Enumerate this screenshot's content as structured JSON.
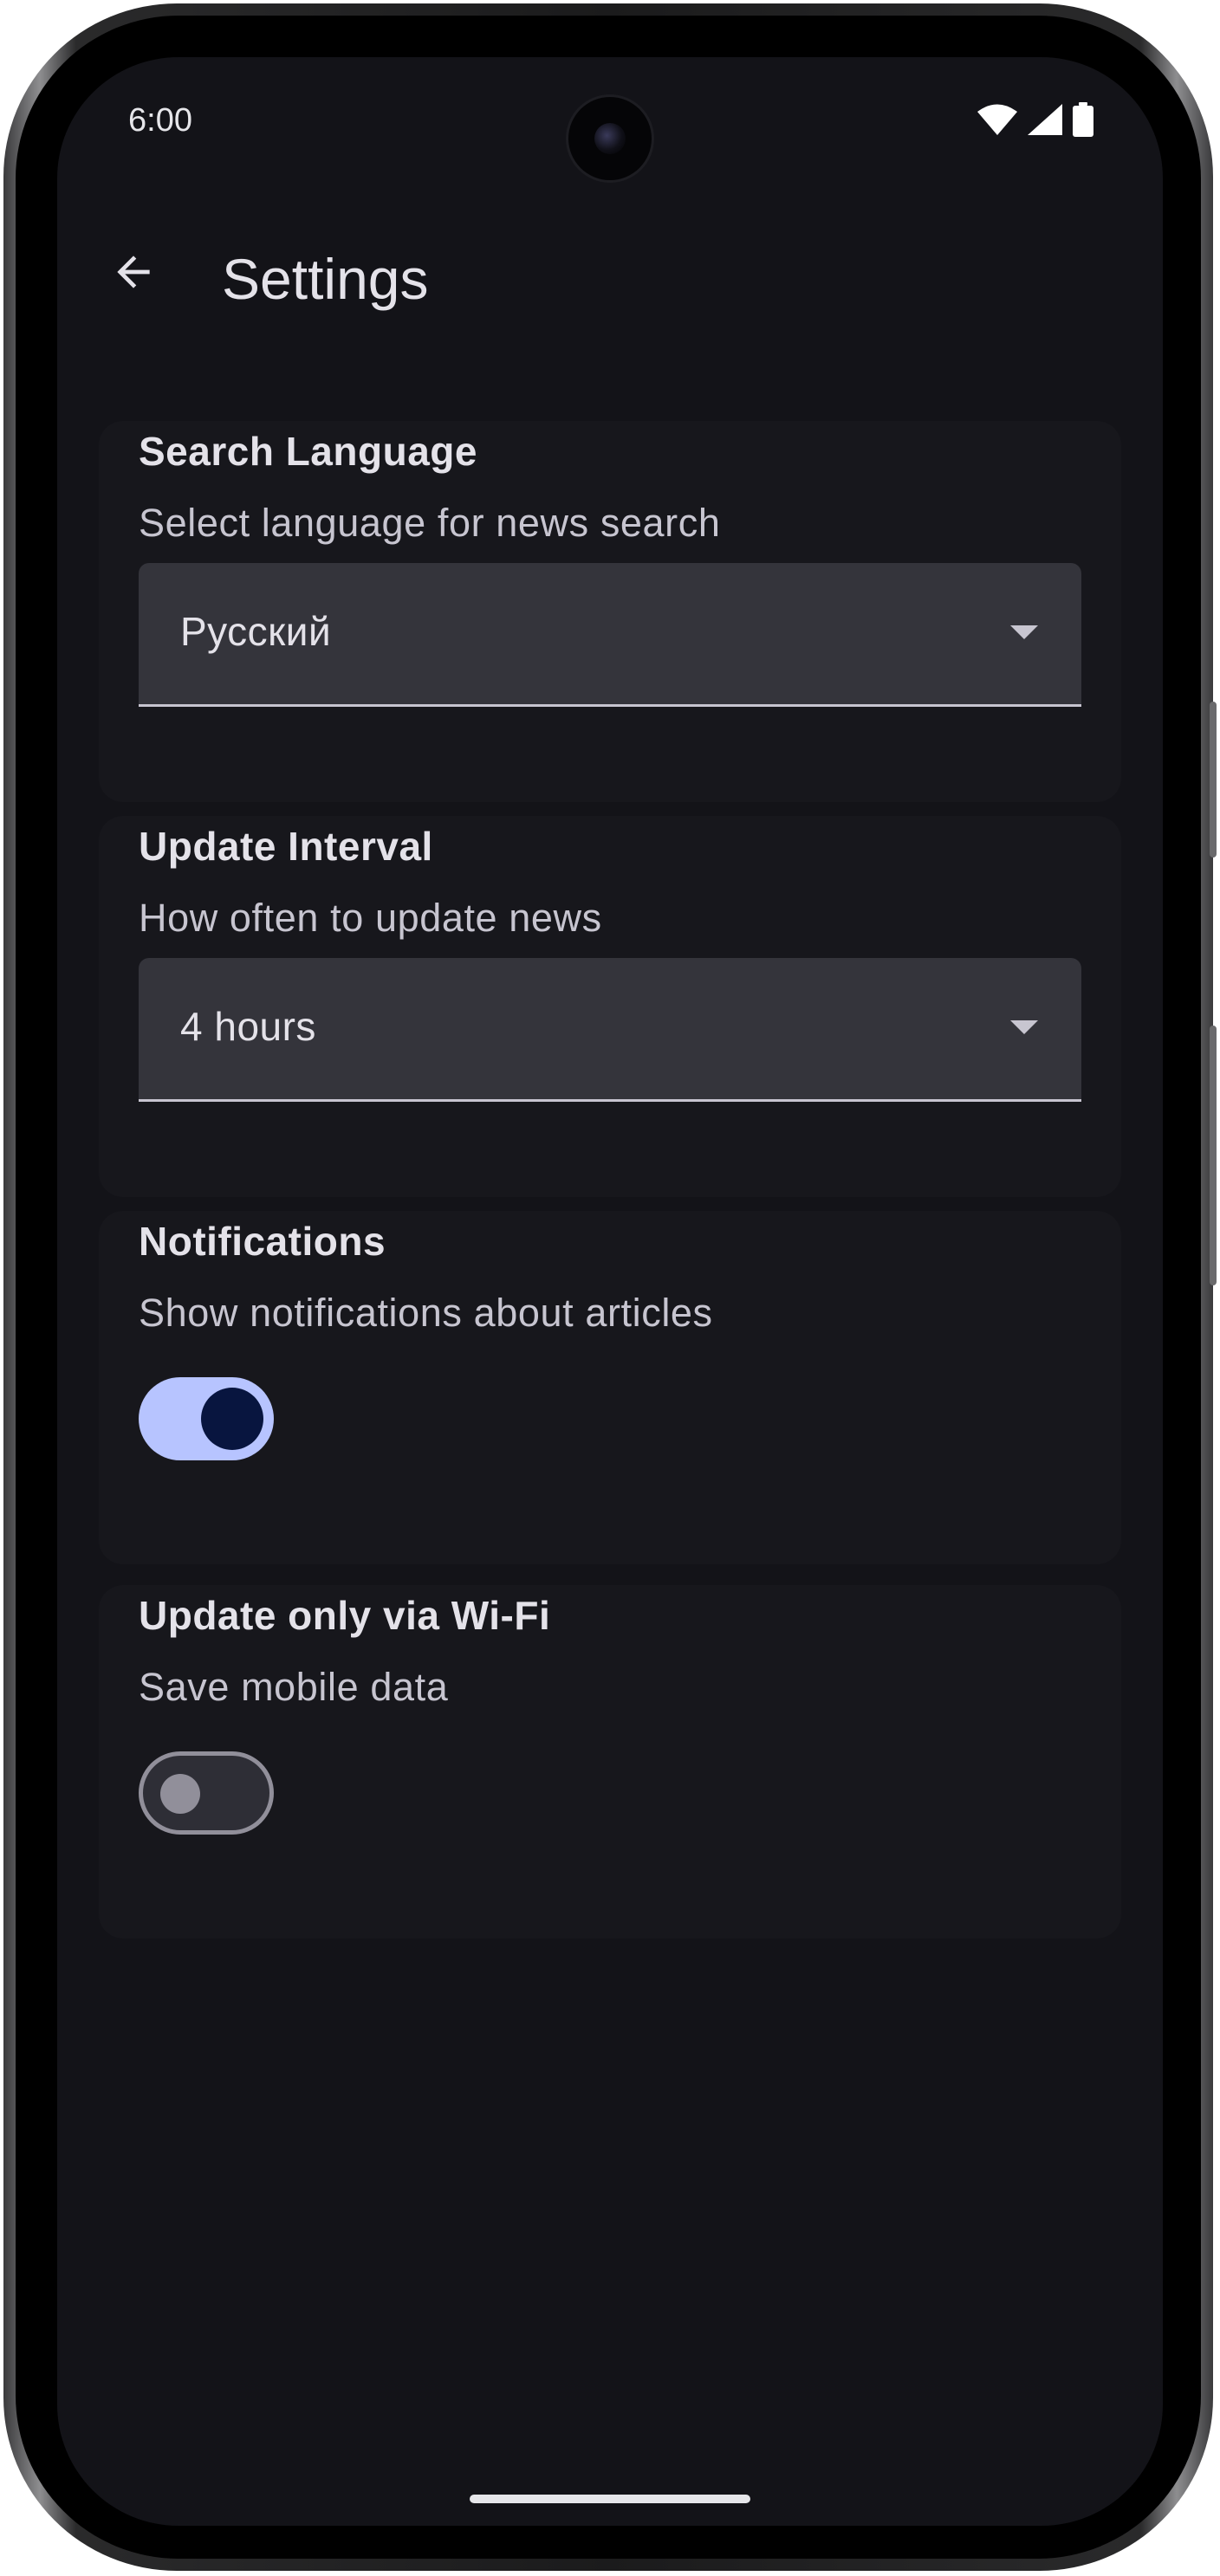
{
  "status_bar": {
    "time": "6:00",
    "icons": [
      "wifi-icon",
      "cellular-signal-icon",
      "battery-icon"
    ]
  },
  "app_bar": {
    "back_icon": "arrow-back-icon",
    "title": "Settings"
  },
  "settings": {
    "search_language": {
      "title": "Search Language",
      "description": "Select language for news search",
      "selected": "Русский"
    },
    "update_interval": {
      "title": "Update Interval",
      "description": "How often to update news",
      "selected": "4 hours"
    },
    "notifications": {
      "title": "Notifications",
      "description": "Show notifications about articles",
      "enabled": true
    },
    "wifi_only": {
      "title": "Update only via Wi-Fi",
      "description": "Save mobile data",
      "enabled": false
    }
  },
  "colors": {
    "background": "#131318",
    "accent": "#b7c4ff",
    "on_accent": "#08153f",
    "text_primary": "#e4e2e9",
    "text_secondary": "#c7c5d0",
    "field_background": "#34343b"
  }
}
